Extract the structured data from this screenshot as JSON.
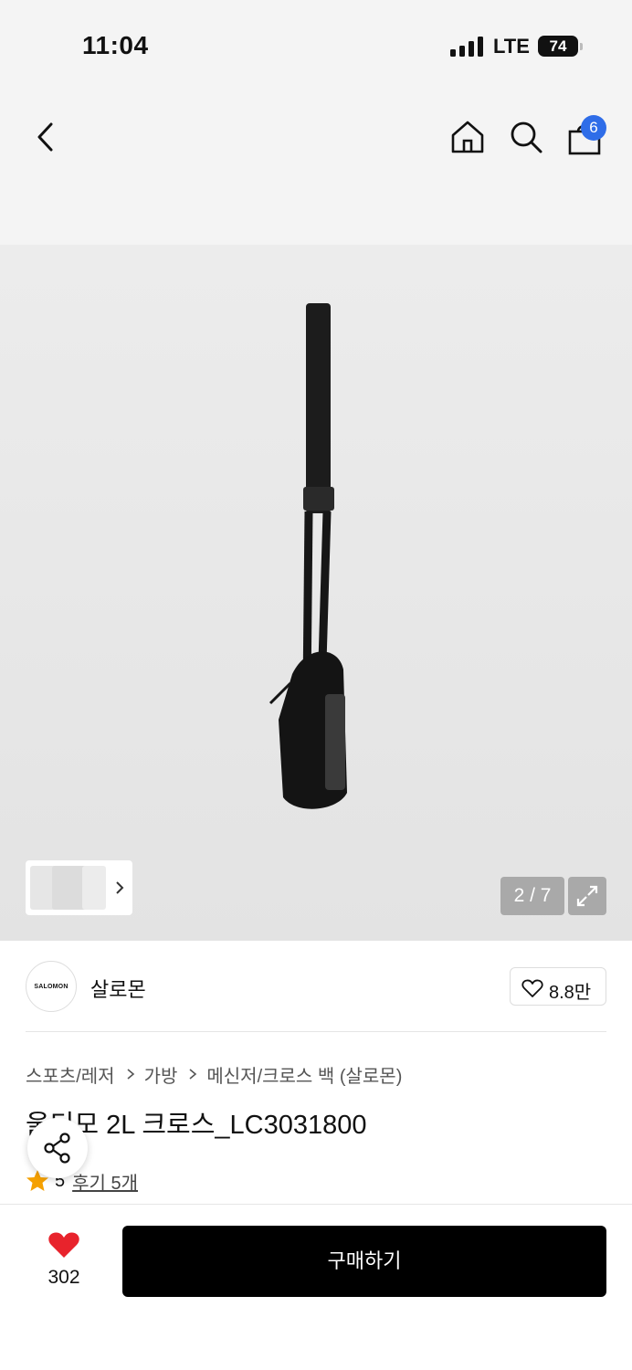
{
  "status_bar": {
    "time": "11:04",
    "network": "LTE",
    "battery": "74"
  },
  "header": {
    "icons": [
      "back-icon",
      "home-icon",
      "search-icon",
      "shopping-bag-icon"
    ],
    "cart_count": "6"
  },
  "gallery": {
    "page_counter": "2 / 7"
  },
  "brand": {
    "logo_text": "SALOMON",
    "name": "살로몬",
    "likes": "8.8만"
  },
  "breadcrumb": [
    "스포츠/레저",
    "가방",
    "메신저/크로스 백 (살로몬)"
  ],
  "product": {
    "title": "울디모 2L 크로스_LC3031800",
    "rating": "5",
    "review_link": "후기 5개"
  },
  "bottom_bar": {
    "wish_count": "302",
    "buy_label": "구매하기"
  },
  "colors": {
    "accent_badge": "#2f6de8",
    "heart": "#e8232c",
    "star": "#f5a000",
    "buy_button": "#000000"
  }
}
